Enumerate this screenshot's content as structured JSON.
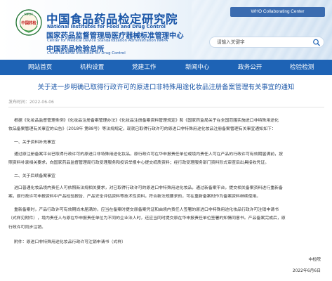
{
  "header": {
    "org_cn": "中国食品药品检定研究院",
    "org_en": "National Institutes for Food and Drug Control",
    "sub_cn": "国家药品监督管理局医疗器械标准管理中心",
    "sub_en": "Center for Medical Device Standardization Administration NMPA",
    "inst_cn": "中国药品检验总所",
    "inst_en": "China National Institutes for Drug Control",
    "logo_text": "NIFDC",
    "logo_inner": "中国药检",
    "who_badge": "WHO Collaborating Center"
  },
  "search": {
    "placeholder": "请输入关键字"
  },
  "nav": {
    "items": [
      "网站首页",
      "机构设置",
      "党建工作",
      "新闻中心",
      "政务公开",
      "检验检测"
    ]
  },
  "colors": {
    "brand_blue": "#1a56a8",
    "nav_blue": "#1e63b5"
  },
  "article": {
    "title": "关于进一步明确已取得行政许可的原进口非特殊用途化妆品注册备案管理有关事宜的通知",
    "date_label": "发布时间：2022-06-06",
    "paragraphs": [
      [
        "根据《化妆品监督管理条例》《化妆品注册备案管理办法》《化妆品注册备案资料管理规定》和《国家药监局关于在全国范围实施进口非特殊用途化",
        "妆品备案管理有关事宜的公告》（2018年 第88号）等法规规定，现就已取得行政许可的原进口非特殊用途化妆品注册备案管理有关事宜通知如下："
      ],
      [
        "一、关于资料补充事宜"
      ],
      [
        "通过原注册备案平台已取得行政许可的原进口非特殊用途化妆品，原行政许可在华申报责任单位或境内责任人可在产品的行政许可有效期届满前，按",
        "照资料补录相关要求，向国家药品监督管理局行政受理服务和投诉举报中心提交纸质资料；经行政受理服务部门资料形式审查后出具接收凭证。"
      ],
      [
        "二、关于后续备案事宜"
      ],
      [
        "进口普通化妆品境内责任人可依照新法规相关要求，对已取得行政许可的原进口非特殊用途化妆品，通过新备案平台，提交相关备案资料进行重新备",
        "案，原行政许可申报资料中产品检验报告、产品安全评估资料等技术性资料，符合新法规要求的，可在重新备案时作为备案资料继续使用。"
      ],
      [
        "重新备案时，产品行政许可有效期尚未届满的，应当在备案时提交原备案凭证和由境内责任人签署的原进口非特殊用途化妆品行政许可注销申请书",
        "（式样见附件），境内责任人与原在华申报责任单位为不同的企业法人时，还应当同时提交原在华申报责任单位签署的知情同意书。产品备案完成后，原",
        "行政许可同步注销。"
      ],
      [
        "附件：原进口非特殊用途化妆品行政许可注销申请书（式样）"
      ]
    ],
    "signature": "中检院",
    "sign_date": "2022年6月6日"
  }
}
